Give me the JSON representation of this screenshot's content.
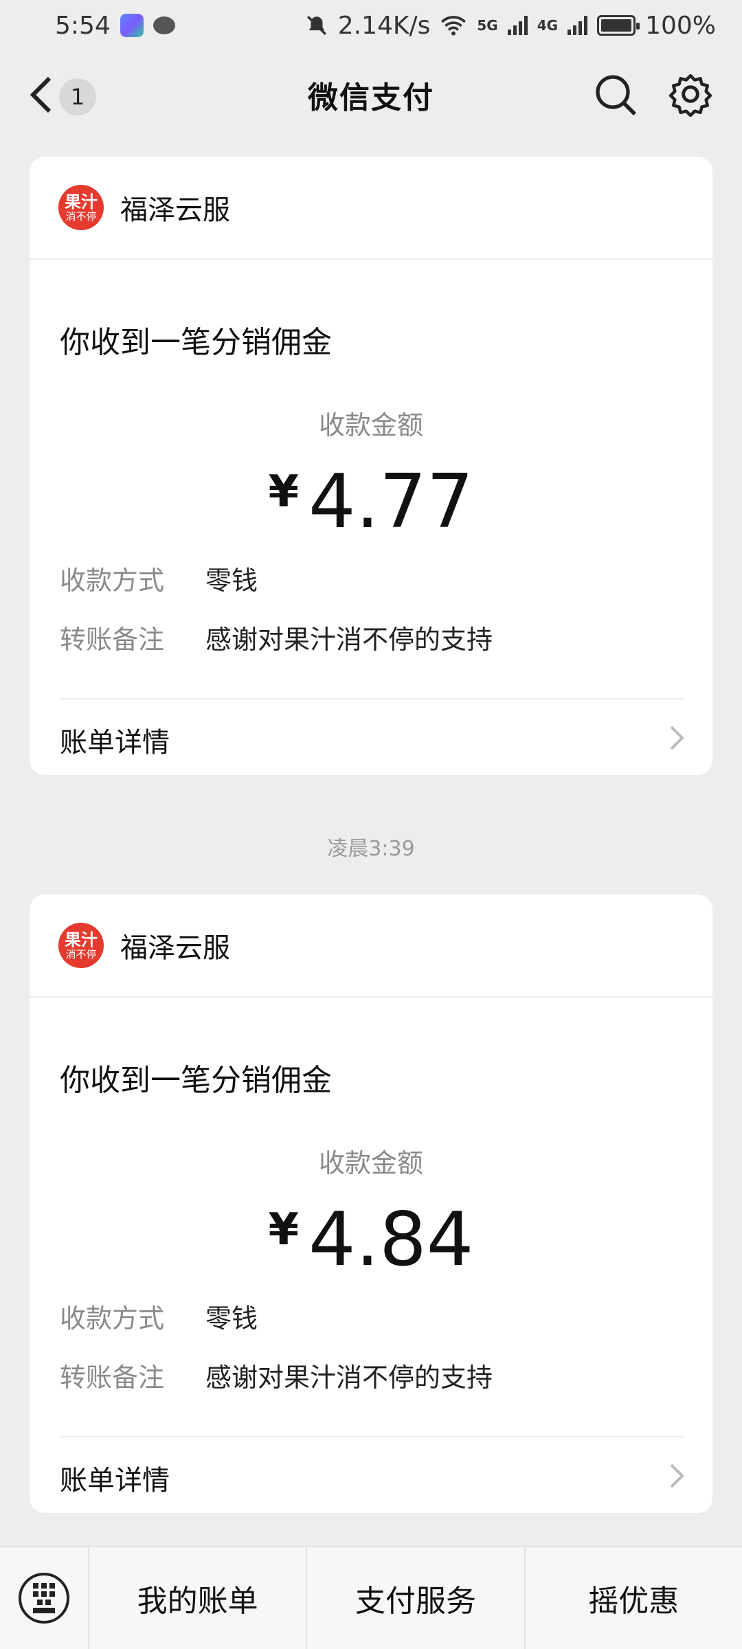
{
  "status_bar": {
    "time": "5:54",
    "network_speed": "2.14K/s",
    "sig1_tag": "5G",
    "sig2_tag": "4G",
    "battery": "100%"
  },
  "nav": {
    "title": "微信支付",
    "unread_count": "1"
  },
  "cards": [
    {
      "merchant": "福泽云服",
      "logo_line1": "果汁",
      "logo_line2": "消不停",
      "title": "你收到一笔分销佣金",
      "amount_label": "收款金额",
      "currency": "¥",
      "amount": "4.77",
      "method_key": "收款方式",
      "method_value": "零钱",
      "note_key": "转账备注",
      "note_value": "感谢对果汁消不停的支持",
      "bill_label": "账单详情"
    },
    {
      "merchant": "福泽云服",
      "logo_line1": "果汁",
      "logo_line2": "消不停",
      "title": "你收到一笔分销佣金",
      "amount_label": "收款金额",
      "currency": "¥",
      "amount": "4.84",
      "method_key": "收款方式",
      "method_value": "零钱",
      "note_key": "转账备注",
      "note_value": "感谢对果汁消不停的支持",
      "bill_label": "账单详情"
    }
  ],
  "timestamp": "凌晨3:39",
  "bottom_menu": {
    "items": [
      "我的账单",
      "支付服务",
      "摇优惠"
    ]
  },
  "colors": {
    "logo_red": "#e53a2e",
    "background": "#ededed"
  }
}
